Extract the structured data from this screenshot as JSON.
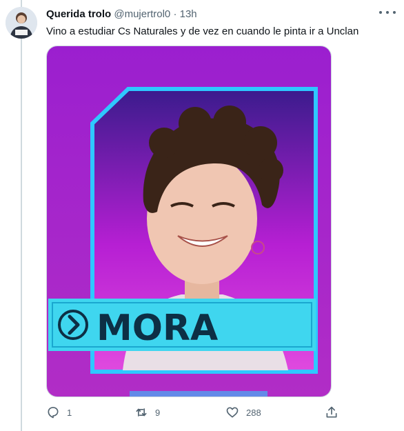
{
  "tweet": {
    "display_name": "Querida trolo",
    "handle": "@mujertrol0",
    "separator": "·",
    "timestamp": "13h",
    "text": "Vino a estudiar Cs Naturales y de vez en cuando le pinta ir a Unclan"
  },
  "media": {
    "card_name": "MORA",
    "colors": {
      "background": "#a21fc9",
      "frame": "#2ec8ff",
      "name_banner": "#3fd6ef",
      "name_text": "#0d2f45"
    }
  },
  "actions": {
    "reply_count": "1",
    "retweet_count": "9",
    "like_count": "288"
  },
  "icons": {
    "reply": "reply-icon",
    "retweet": "retweet-icon",
    "like": "heart-icon",
    "share": "share-icon",
    "more": "more-icon",
    "chevron": "chevron-right-circle-icon"
  }
}
